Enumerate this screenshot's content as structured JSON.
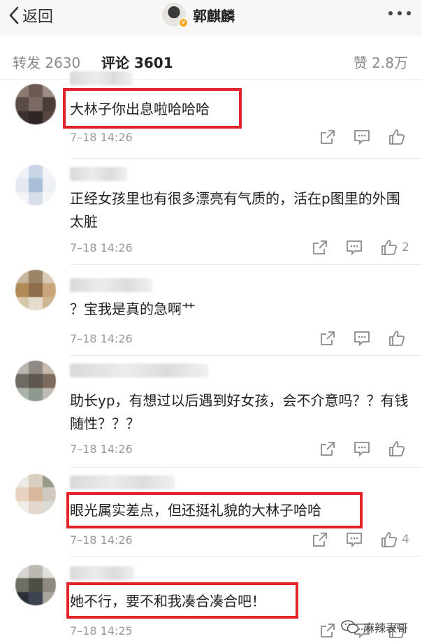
{
  "header": {
    "back_label": "返回",
    "title": "郭麒麟"
  },
  "tabs": {
    "repost": "转发 2630",
    "comment": "评论 3601",
    "like": "赞 2.8万"
  },
  "comments": [
    {
      "text": "大林子你出息啦哈哈哈",
      "time": "7–18 14:26",
      "likes": "",
      "highlighted": true
    },
    {
      "text": "正经女孩里也有很多漂亮有气质的，活在p图里的外围太脏",
      "time": "7–18 14:26",
      "likes": "2",
      "highlighted": false
    },
    {
      "text": "？宝我是真的急啊艹",
      "time": "7–18 14:26",
      "likes": "",
      "highlighted": false
    },
    {
      "text": "助长yp，有想过以后遇到好女孩，会不介意吗？？有钱随性？？？",
      "time": "7–18 14:26",
      "likes": "",
      "highlighted": false
    },
    {
      "text": "眼光属实差点，但还挺礼貌的大林子哈哈",
      "time": "7–18 14:26",
      "likes": "4",
      "highlighted": true
    },
    {
      "text": "她不行，要不和我凑合凑合吧！",
      "time": "7–18 14:25",
      "likes": "",
      "highlighted": true
    }
  ],
  "watermark": "麻辣表哥",
  "colors": {
    "highlight_box": "#e4222a",
    "accent_badge": "#f7a31b"
  }
}
